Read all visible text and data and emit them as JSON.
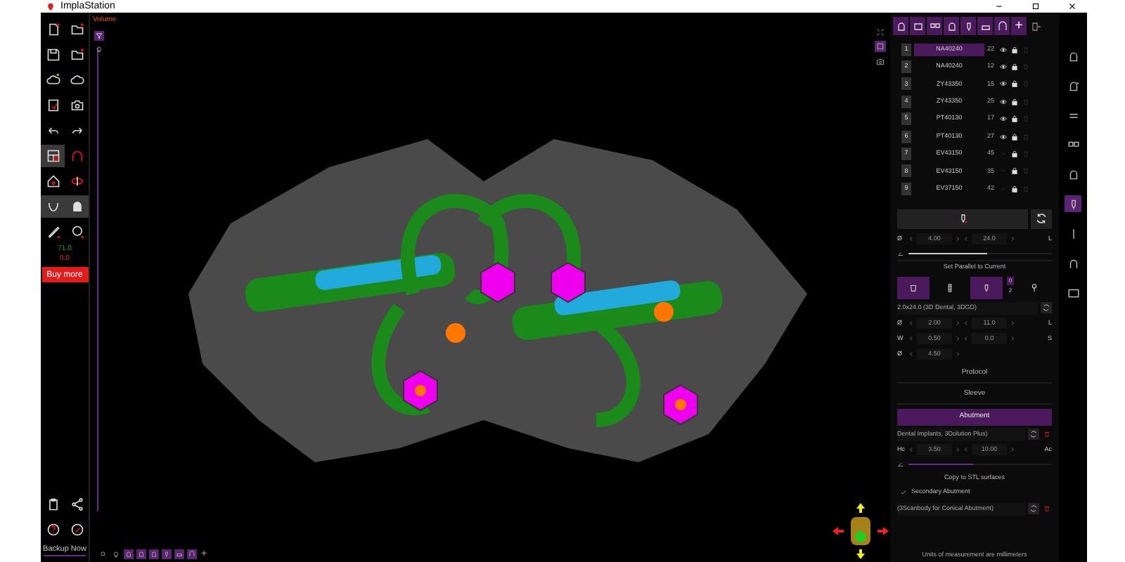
{
  "window": {
    "title": "ImplaStation"
  },
  "left_toolbar": {
    "tools": [
      {
        "selected": false
      },
      {
        "selected": false
      },
      {
        "selected": false
      },
      {
        "selected": false
      },
      {
        "selected": false
      },
      {
        "selected": false
      },
      {
        "selected": false
      },
      {
        "selected": false
      },
      {
        "selected": false
      },
      {
        "selected": false
      },
      {
        "selected": true
      },
      {
        "selected": false
      },
      {
        "selected": false
      },
      {
        "selected": false
      },
      {
        "selected": true
      },
      {
        "selected": true
      },
      {
        "selected": false
      },
      {
        "selected": false
      }
    ],
    "reading_1": "71.0",
    "reading_2": "0.0",
    "buy_button": "Buy more",
    "backup_button": "Backup Now"
  },
  "viewport": {
    "view_label": "Volume",
    "add_label": "+"
  },
  "implant_panel": {
    "add_label": "+",
    "implants": [
      {
        "number": "1",
        "code": "NA40240",
        "tooth": "22",
        "visible": true,
        "selected": true
      },
      {
        "number": "2",
        "code": "NA40240",
        "tooth": "12",
        "visible": true,
        "selected": false
      },
      {
        "number": "3",
        "code": "ZY43350",
        "tooth": "15",
        "visible": true,
        "selected": false
      },
      {
        "number": "4",
        "code": "ZY43350",
        "tooth": "25",
        "visible": true,
        "selected": false
      },
      {
        "number": "5",
        "code": "PT40130",
        "tooth": "17",
        "visible": true,
        "selected": false
      },
      {
        "number": "6",
        "code": "PT40130",
        "tooth": "27",
        "visible": true,
        "selected": false
      },
      {
        "number": "7",
        "code": "EV43150",
        "tooth": "45",
        "visible": false,
        "selected": false
      },
      {
        "number": "8",
        "code": "EV43150",
        "tooth": "35",
        "visible": false,
        "selected": false
      },
      {
        "number": "9",
        "code": "EV37150",
        "tooth": "42",
        "visible": false,
        "selected": false
      }
    ],
    "sleeve_params": {
      "label": "Ø",
      "value_1": "4.00",
      "value_2": "24.0",
      "unit": "L"
    },
    "sleeve_slider": {
      "level": 0.55
    },
    "parallel_button": "Set Parallel to Current",
    "types": [
      {
        "selected": true
      },
      {
        "selected": false
      },
      {
        "selected": true,
        "count_1": "0",
        "count_2": "2"
      },
      {
        "selected": false
      }
    ],
    "implant_name": "2.0x24.0 (3D Dental, 3DGD)",
    "implant_params": [
      {
        "label": "Ø",
        "value_1": "2.00",
        "value_2": "11.0",
        "unit": "L"
      },
      {
        "label": "W",
        "value_1": "0.50",
        "value_2": "0.0",
        "unit": "S"
      },
      {
        "label": "Ø",
        "value_1": "4.50"
      }
    ],
    "sections": [
      {
        "title": "Protocol",
        "selected": false
      },
      {
        "title": "Sleeve",
        "selected": false
      },
      {
        "title": "Abutment",
        "selected": true
      }
    ],
    "abutment_name": "Dental Implants, 3Dolution Plus)",
    "abutment_params": {
      "label": "Hc",
      "value_1": "3.50",
      "value_2": "10.00",
      "unit": "Ac"
    },
    "abutment_slider": {
      "level": 0.45
    },
    "copy_button": "Copy to STL surfaces",
    "secondary": {
      "label": "Secondary Abutment",
      "checked": true
    },
    "scanbody_name": "(3Scanbody for Conical Abutment)",
    "units_note": "Units of measurement are millimeters"
  },
  "right_sidebar": {
    "items": [
      {
        "selected": false
      },
      {
        "selected": false
      },
      {
        "selected": false
      },
      {
        "selected": false
      },
      {
        "selected": false
      },
      {
        "selected": true
      },
      {
        "selected": false
      },
      {
        "selected": false
      },
      {
        "selected": false
      }
    ]
  }
}
